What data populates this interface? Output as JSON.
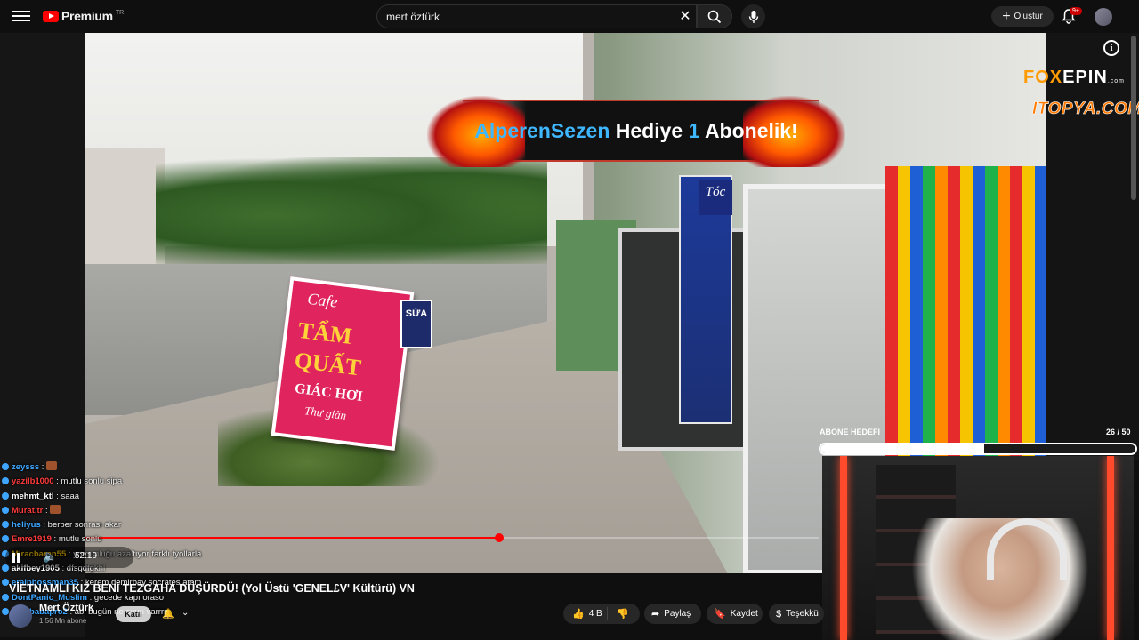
{
  "app": {
    "logo_text": "Premium",
    "logo_region": "TR"
  },
  "header": {
    "search_value": "mert öztürk",
    "create_label": "Oluştur",
    "notifications_badge": "9+"
  },
  "overlay": {
    "gift": {
      "user": "AlperenSezen",
      "middle": "Hediye",
      "count": "1",
      "suffix": "Abonelik!"
    },
    "sponsor_1": {
      "prefix": "FOX",
      "suffix": "EPIN",
      "small": ".com"
    },
    "sponsor_2": "ITOPYA.COM",
    "sub_goal": {
      "label": "ABONE HEDEFİ",
      "count": "26 / 50",
      "progress_fraction": 0.52
    }
  },
  "scene_signs": {
    "cafe": "Cafe",
    "line2": "TẨM",
    "line3": "QUẤT",
    "line4": "GIÁC HƠI",
    "line5": "Thư giãn",
    "sua": "SỬA",
    "toc": "Tóc"
  },
  "player": {
    "time": "52:19",
    "progress_fraction": 0.565
  },
  "chat": [
    {
      "user": "zeysss",
      "sep": " : ",
      "text": "",
      "emote": true,
      "color": "#3ea6ff"
    },
    {
      "user": "yazilb1000",
      "sep": " : ",
      "text": "mutlu sonlu sipa",
      "emote": false,
      "color": "#ff3b3b"
    },
    {
      "user": "mehmt_ktl",
      "sep": " : ",
      "text": "saaa",
      "emote": false,
      "color": "#ffffff"
    },
    {
      "user": "Murat.tr",
      "sep": " : ",
      "text": "",
      "emote": true,
      "color": "#ff3b3b"
    },
    {
      "user": "heliyus",
      "sep": " : ",
      "text": "berber sonrası akar",
      "emote": false,
      "color": "#3ea6ff"
    },
    {
      "user": "Emre1919",
      "sep": " : ",
      "text": "mutlu sonlu",
      "emote": false,
      "color": "#ff3b3b"
    },
    {
      "user": "Miracbaran55",
      "sep": " : ",
      "text": "yorgunluğu azaltıyor farklı tyollarla",
      "emote": false,
      "color": "#f6c400"
    },
    {
      "user": "akifbey1905",
      "sep": " : ",
      "text": "dfsgdfgkhl",
      "emote": false,
      "color": "#ffffff"
    },
    {
      "user": "eralpbossman35",
      "sep": " : ",
      "text": "kerem demirbay socrates atom",
      "emote": false,
      "color": "#3ea6ff"
    },
    {
      "user": "DontPanic_Muslim",
      "sep": " : ",
      "text": "gecede kapı oraso",
      "emote": false,
      "color": "#3ea6ff"
    },
    {
      "user": "wwebabapro2",
      "sep": " : ",
      "text": "abi bugün ne oyun varrrrr",
      "emote": false,
      "color": "#3ea6ff"
    }
  ],
  "video": {
    "title": "VİETNAMLI KIZ BENİ TEZGAHA DÜŞÜRDÜ! (Yol Üstü 'GENEL£V' Kültürü) VN",
    "channel": "Mert Öztürk",
    "subs": "1,56 Mn abone",
    "join_label": "Katıl",
    "like_count": "4 B",
    "share_label": "Paylaş",
    "save_label": "Kaydet",
    "thanks_label": "Teşekkü"
  }
}
